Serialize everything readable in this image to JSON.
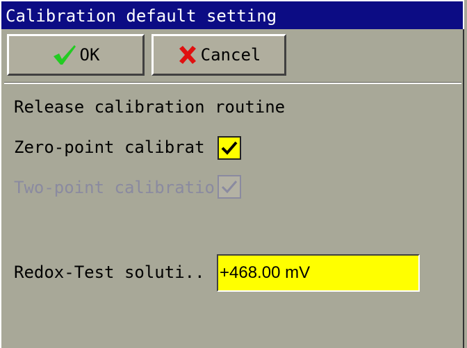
{
  "window": {
    "title": "Calibration default setting"
  },
  "toolbar": {
    "ok_label": "OK",
    "cancel_label": "Cancel"
  },
  "form": {
    "section_heading": "Release calibration routine",
    "zero_point": {
      "label": "Zero-point calibrat",
      "checked": true,
      "enabled": true
    },
    "two_point": {
      "label": "Two-point calibratio",
      "checked": true,
      "enabled": false
    },
    "redox": {
      "label": "Redox-Test soluti..",
      "value": "+468.00 mV"
    }
  },
  "colors": {
    "title_bar": "#0c0c84",
    "background": "#a8a898",
    "highlight_field": "#ffff00",
    "ok_icon": "#22cc22",
    "cancel_icon": "#e01010",
    "disabled_text": "#8a8aa0"
  },
  "icons": {
    "ok": "checkmark-icon",
    "cancel": "x-icon",
    "checkbox_mark": "checkmark-icon"
  }
}
